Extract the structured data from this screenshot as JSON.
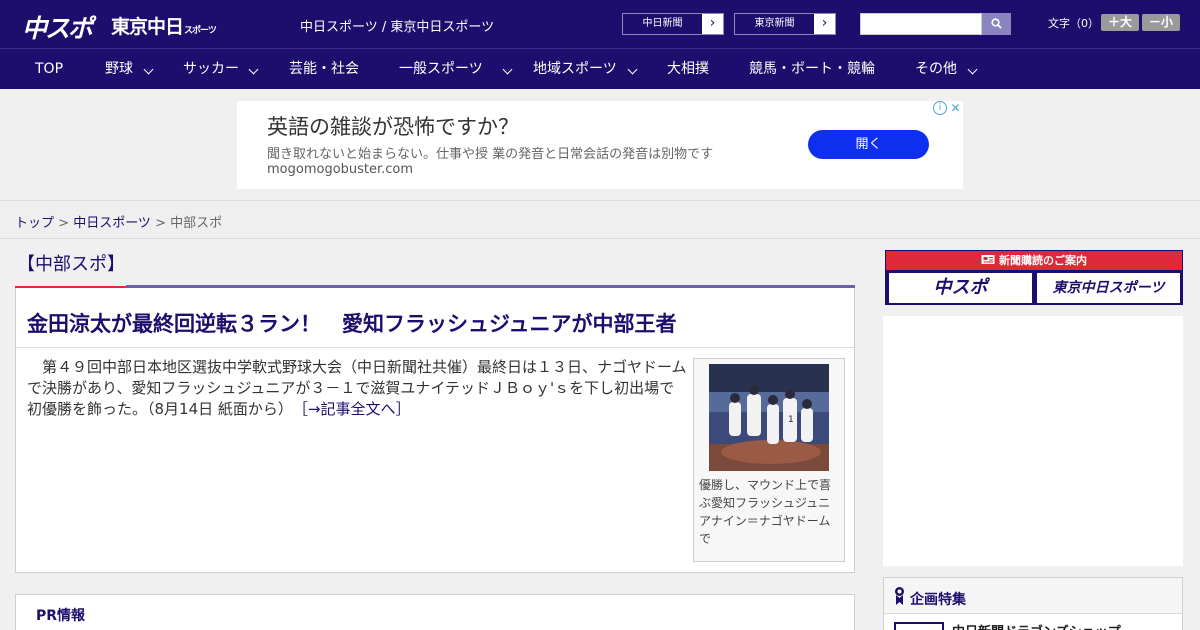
{
  "header": {
    "logo_chuspo": "中スポ",
    "logo_tokyo": "東京中日",
    "logo_tokyo_suffix": "スポーツ",
    "site_title": "中日スポーツ / 東京中日スポーツ",
    "paper_links": [
      {
        "label": "中日新聞",
        "arrow": "›"
      },
      {
        "label": "東京新聞",
        "arrow": "›"
      }
    ],
    "search_placeholder": "",
    "font_size_label": "文字（0）",
    "font_bigger": "＋大",
    "font_smaller": "－小"
  },
  "nav": {
    "items": [
      {
        "label": "TOP"
      },
      {
        "label": "野球"
      },
      {
        "label": "サッカー"
      },
      {
        "label": "芸能・社会"
      },
      {
        "label": "一般スポーツ"
      },
      {
        "label": "地域スポーツ"
      },
      {
        "label": "大相撲"
      },
      {
        "label": "競馬・ボート・競輪"
      },
      {
        "label": "その他"
      }
    ]
  },
  "ad": {
    "headline": "英語の雑談が恐怖ですか？",
    "subtext": "聞き取れないと始まらない。仕事や授 業の発音と日常会話の発音は別物です",
    "url": "mogomogobuster.com",
    "button": "開く",
    "info_icon": "i",
    "close_icon": "✕"
  },
  "breadcrumb": {
    "items": [
      "トップ",
      "中日スポーツ",
      "中部スポ"
    ],
    "separator": " > "
  },
  "section": {
    "title": "【中部スポ】"
  },
  "article": {
    "title": "金田涼太が最終回逆転３ラン！　愛知フラッシュジュニアが中部王者",
    "body": "　第４９回中部日本地区選抜中学軟式野球大会（中日新聞社共催）最終日は１３日、ナゴヤドームで決勝があり、愛知フラッシュジュニアが３－１で滋賀ユナイテッドＪＢｏｙ'ｓを下し初出場で初優勝を飾った。（8月14日 紙面から）",
    "more_link": "［→記事全文へ］",
    "photo_caption": "優勝し、マウンド上で喜ぶ愛知フラッシュジュニアナイン＝ナゴヤドームで"
  },
  "pr": {
    "title": "PR情報"
  },
  "sidebar": {
    "subscribe_head": "新聞購読のご案内",
    "subscribe_logos": [
      "中スポ",
      "東京中日スポーツ"
    ],
    "feature_title": "企画特集",
    "feature_item": "中日新聞ドラゴンズショップ"
  },
  "colors": {
    "brand_navy": "#1d0e6e",
    "accent_red": "#e0283c",
    "ad_button_blue": "#0e2ff0"
  }
}
